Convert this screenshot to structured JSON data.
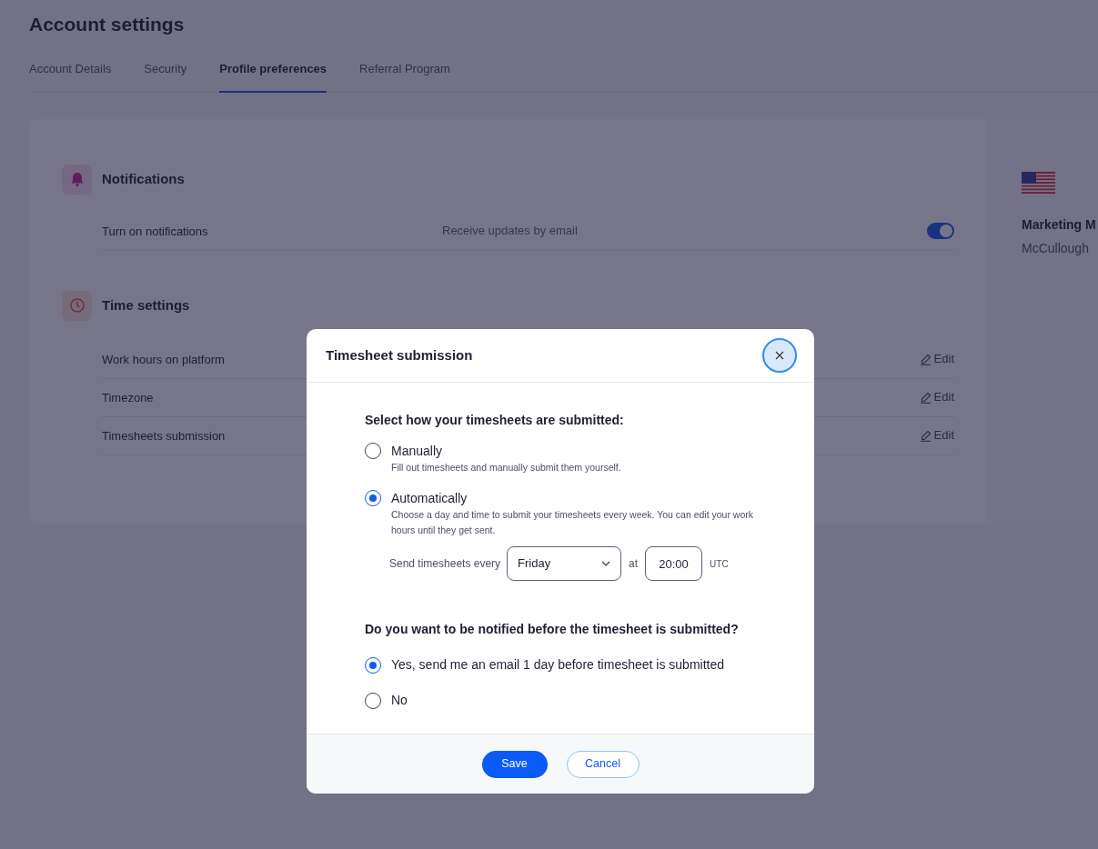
{
  "page_title": "Account settings",
  "tabs": [
    {
      "label": "Account Details",
      "selected": false
    },
    {
      "label": "Security",
      "selected": false
    },
    {
      "label": "Profile preferences",
      "selected": true
    },
    {
      "label": "Referral Program",
      "selected": false
    }
  ],
  "sections": [
    {
      "kind": "notifications",
      "title": "Notifications",
      "rows": [
        {
          "kind": "toggle",
          "label": "Turn on notifications",
          "description": "Receive updates by email",
          "on": true
        }
      ]
    },
    {
      "kind": "time",
      "title": "Time settings",
      "rows": [
        {
          "kind": "edit",
          "label": "Work hours on platform",
          "action": "Edit"
        },
        {
          "kind": "edit",
          "label": "Timezone",
          "action": "Edit"
        },
        {
          "kind": "edit",
          "label": "Timesheets submission",
          "action": "Edit"
        }
      ]
    }
  ],
  "side_panel": {
    "job_title": "Marketing M",
    "company": "McCullough"
  },
  "modal": {
    "title": "Timesheet submission",
    "question_1": "Select how your timesheets are submitted:",
    "submit_options": [
      {
        "label": "Manually",
        "description": "Fill out timesheets and manually submit them yourself.",
        "selected": false
      },
      {
        "label": "Automatically",
        "description": "Choose a day and time to submit your timesheets every week. You can edit your work hours until they get sent.",
        "selected": true
      }
    ],
    "schedule": {
      "label": "Send timesheets every",
      "day": "Friday",
      "at": "at",
      "time": "20:00",
      "timezone": "UTC"
    },
    "question_2": "Do you want to be notified before the timesheet is submitted?",
    "notify_options": [
      {
        "label": "Yes, send me an email 1 day before timesheet is submitted",
        "selected": true
      },
      {
        "label": "No",
        "selected": false
      }
    ],
    "buttons": [
      {
        "kind": "primary",
        "label": "Save"
      },
      {
        "kind": "secondary",
        "label": "Cancel"
      }
    ]
  }
}
